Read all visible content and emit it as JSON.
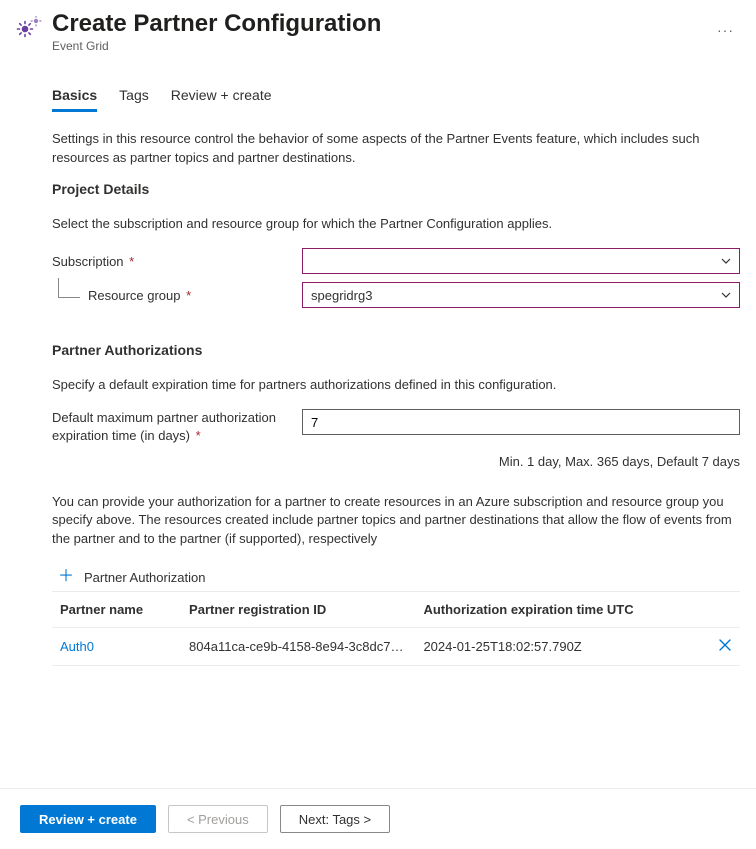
{
  "header": {
    "title": "Create Partner Configuration",
    "subtitle": "Event Grid",
    "more": "···"
  },
  "tabs": [
    {
      "label": "Basics"
    },
    {
      "label": "Tags"
    },
    {
      "label": "Review + create"
    }
  ],
  "active_tab": 0,
  "intro": "Settings in this resource control the behavior of some aspects of the Partner Events feature, which includes such resources as partner topics and partner destinations.",
  "project": {
    "heading": "Project Details",
    "desc": "Select the subscription and resource group for which the Partner Configuration applies.",
    "subscription_label": "Subscription",
    "subscription_value": "",
    "rg_label": "Resource group",
    "rg_value": "spegridrg3"
  },
  "auth": {
    "heading": "Partner Authorizations",
    "desc": "Specify a default expiration time for partners authorizations defined in this configuration.",
    "exp_label": "Default maximum partner authorization expiration time (in days)",
    "exp_value": "7",
    "exp_hint": "Min. 1 day, Max. 365 days, Default 7 days",
    "desc2": "You can provide your authorization for a partner to create resources in an Azure subscription and resource group you specify above. The resources created include partner topics and partner destinations that allow the flow of events from the partner and to the partner (if supported), respectively",
    "add_label": "Partner Authorization",
    "columns": [
      "Partner name",
      "Partner registration ID",
      "Authorization expiration time UTC"
    ],
    "rows": [
      {
        "name": "Auth0",
        "reg_id": "804a11ca-ce9b-4158-8e94-3c8dc7…",
        "exp": "2024-01-25T18:02:57.790Z"
      }
    ]
  },
  "footer": {
    "review": "Review + create",
    "prev": "< Previous",
    "next": "Next: Tags >"
  }
}
